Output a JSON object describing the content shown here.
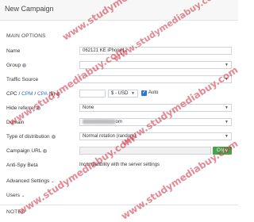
{
  "header": {
    "title": "New Campaign"
  },
  "section": {
    "main_options": "MAIN OPTIONS",
    "notes": "NOTES"
  },
  "form": {
    "name": {
      "label": "Name",
      "value": "062121 KE iPhone12"
    },
    "group": {
      "label": "Group",
      "value": ""
    },
    "traffic_source": {
      "label": "Traffic Source",
      "value": ""
    },
    "cost": {
      "label_cpc": "CPC",
      "sep1": " / ",
      "label_cpm": "CPM",
      "sep2": " / ",
      "label_cpa": "CPA",
      "label_suffix": " ($)",
      "value": "",
      "currency": "$ - USD",
      "auto_label": "Auto",
      "auto_checked": true
    },
    "hide_referrer": {
      "label": "Hide referrer",
      "value": "None"
    },
    "domain": {
      "label": "Domain",
      "value_suffix": "om"
    },
    "distribution": {
      "label": "Type of distribution",
      "value": "Normal rotation (random)"
    },
    "campaign_url": {
      "label": "Campaign URL",
      "copy_label": "Copy"
    },
    "anti_spy": {
      "label": "Anti-Spy Beta",
      "value": "Incompatibility with the server settings"
    }
  },
  "collapsibles": {
    "advanced": "Advanced Settings",
    "users": "Users"
  },
  "watermark": {
    "text": "www.studymediabuy.com"
  },
  "colors": {
    "accent": "#2f77d1",
    "copy_button": "#46a34a",
    "watermark": "#cd283c"
  }
}
